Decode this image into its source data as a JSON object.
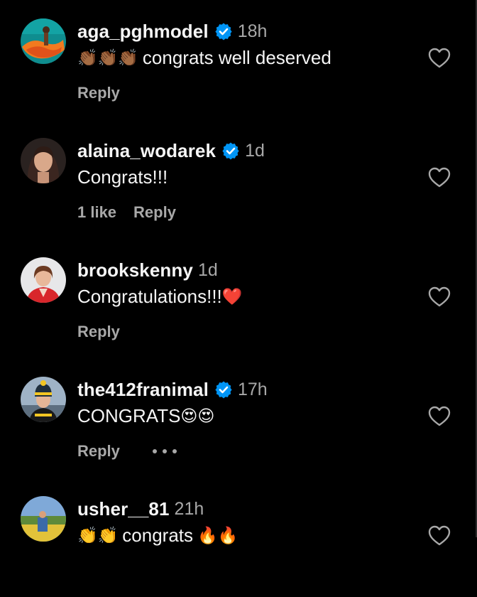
{
  "comments": [
    {
      "username": "aga_pghmodel",
      "verified": true,
      "time": "18h",
      "text": "congrats well deserved",
      "leading_emoji": "👏🏾👏🏾👏🏾",
      "trailing_emoji": "",
      "likes": "",
      "reply_label": "Reply",
      "avatar": "orange-dress-photo"
    },
    {
      "username": "alaina_wodarek",
      "verified": true,
      "time": "1d",
      "text": "Congrats!!!",
      "leading_emoji": "",
      "trailing_emoji": "",
      "likes": "1 like",
      "reply_label": "Reply",
      "avatar": "woman-dark-hair-photo"
    },
    {
      "username": "brookskenny",
      "verified": false,
      "time": "1d",
      "text": "Congratulations!!!",
      "leading_emoji": "",
      "trailing_emoji": "❤️",
      "likes": "",
      "reply_label": "Reply",
      "avatar": "woman-red-blazer-photo"
    },
    {
      "username": "the412franimal",
      "verified": true,
      "time": "17h",
      "text": "CONGRATS",
      "leading_emoji": "",
      "trailing_emoji": "😍😍",
      "likes": "",
      "reply_label": "Reply",
      "more_options": true,
      "avatar": "woman-winter-hat-photo"
    },
    {
      "username": "usher__81",
      "verified": false,
      "time": "21h",
      "text": "congrats",
      "leading_emoji": "👏👏",
      "trailing_emoji": "🔥🔥",
      "likes": "",
      "reply_label": "Reply",
      "avatar": "outdoor-group-photo"
    }
  ],
  "colors": {
    "background": "#000000",
    "primary_text": "#f5f5f5",
    "secondary_text": "#a8a8a8",
    "verified_badge": "#0095f6"
  },
  "icons": {
    "verified": "verified-badge-icon",
    "like": "heart-outline-icon",
    "more": "more-options-icon"
  }
}
